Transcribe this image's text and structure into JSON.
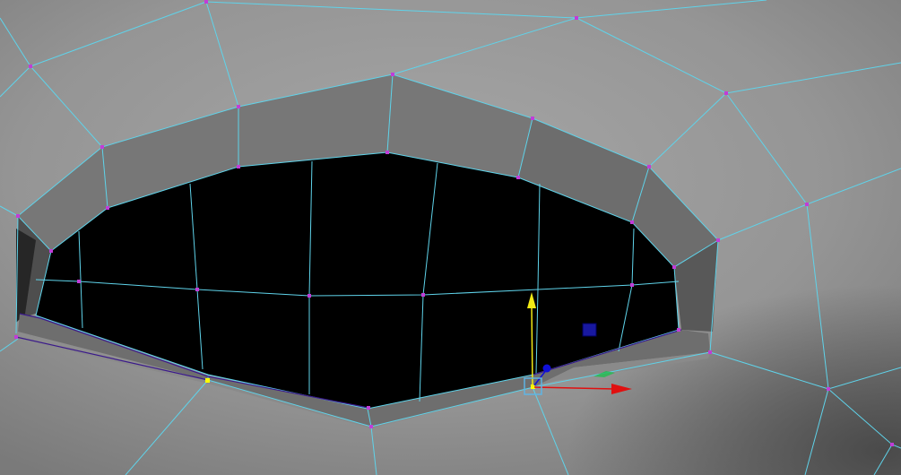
{
  "viewport": {
    "kind": "3d-modeling-viewport",
    "object": "polygon mesh",
    "selection_mode": "vertex",
    "active_tool": "move",
    "icons": [
      "move-manipulator-icon",
      "x-axis-arrow-icon",
      "y-axis-arrow-icon",
      "z-axis-handle-icon",
      "plane-handle-icon",
      "center-box-icon"
    ]
  },
  "colors": {
    "surface_light": "#9c9c9c",
    "surface_mid": "#8a8a8a",
    "bevel_top": "#767676",
    "bevel_side": "#525252",
    "lip": "#6e6e6e",
    "interior": "#000000",
    "wireframe": "#5fd3ea",
    "vertex": "#c13cd8",
    "selected_vertex": "#ffff00",
    "selected_edge": "#3b1a8a",
    "axis_x": "#e01010",
    "axis_y": "#f2ea14",
    "axis_z": "#1010d8",
    "plane_handle": "#1818a0",
    "manip_box": "#5fb4e4"
  }
}
